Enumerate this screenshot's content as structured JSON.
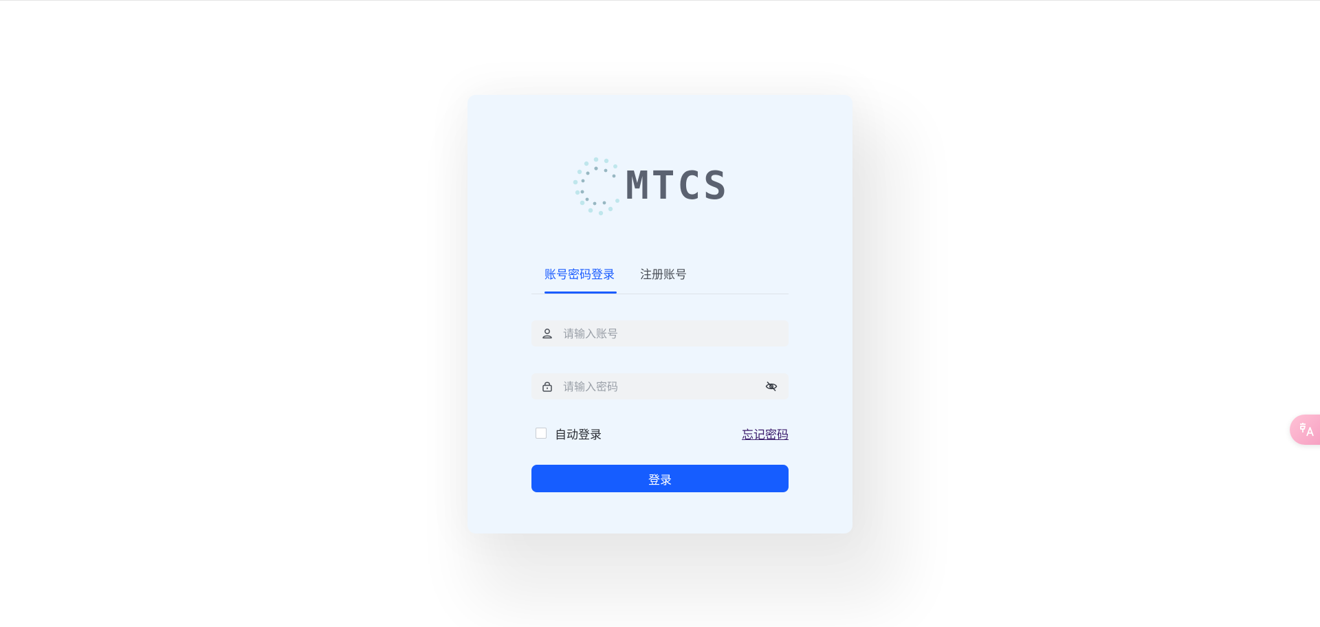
{
  "logo": {
    "text": "MTCS"
  },
  "tabs": [
    {
      "label": "账号密码登录",
      "active": true
    },
    {
      "label": "注册账号",
      "active": false
    }
  ],
  "form": {
    "account_placeholder": "请输入账号",
    "password_placeholder": "请输入密码",
    "remember_label": "自动登录",
    "forgot_label": "忘记密码",
    "login_label": "登录"
  },
  "icons": {
    "account": "user-icon",
    "password": "lock-icon",
    "toggle_visibility": "eye-off-icon",
    "translate": "translate-icon"
  },
  "colors": {
    "accent": "#165dff",
    "card_bg": "#eef6fe",
    "logo_text": "#5b6270",
    "fab": "#f59bbf"
  }
}
